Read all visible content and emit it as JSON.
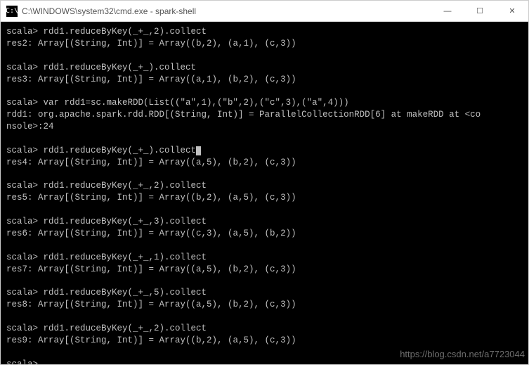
{
  "titlebar": {
    "icon_label": "C:\\",
    "title": "C:\\WINDOWS\\system32\\cmd.exe - spark-shell"
  },
  "window_controls": {
    "minimize": "—",
    "maximize": "☐",
    "close": "✕"
  },
  "terminal": {
    "blocks": [
      {
        "cmd": "scala> rdd1.reduceByKey(_+_,2).collect",
        "out": "res2: Array[(String, Int)] = Array((b,2), (a,1), (c,3))"
      },
      {
        "cmd": "scala> rdd1.reduceByKey(_+_).collect",
        "out": "res3: Array[(String, Int)] = Array((a,1), (b,2), (c,3))"
      },
      {
        "cmd": "scala> var rdd1=sc.makeRDD(List((\"a\",1),(\"b\",2),(\"c\",3),(\"a\",4)))",
        "out": "rdd1: org.apache.spark.rdd.RDD[(String, Int)] = ParallelCollectionRDD[6] at makeRDD at <co",
        "out2": "nsole>:24"
      },
      {
        "cmd": "scala> rdd1.reduceByKey(_+_).collect",
        "cursor": true,
        "out": "res4: Array[(String, Int)] = Array((a,5), (b,2), (c,3))"
      },
      {
        "cmd": "scala> rdd1.reduceByKey(_+_,2).collect",
        "out": "res5: Array[(String, Int)] = Array((b,2), (a,5), (c,3))"
      },
      {
        "cmd": "scala> rdd1.reduceByKey(_+_,3).collect",
        "out": "res6: Array[(String, Int)] = Array((c,3), (a,5), (b,2))"
      },
      {
        "cmd": "scala> rdd1.reduceByKey(_+_,1).collect",
        "out": "res7: Array[(String, Int)] = Array((a,5), (b,2), (c,3))"
      },
      {
        "cmd": "scala> rdd1.reduceByKey(_+_,5).collect",
        "out": "res8: Array[(String, Int)] = Array((a,5), (b,2), (c,3))"
      },
      {
        "cmd": "scala> rdd1.reduceByKey(_+_,2).collect",
        "out": "res9: Array[(String, Int)] = Array((b,2), (a,5), (c,3))"
      }
    ],
    "prompt_last": "scala>"
  },
  "watermark": "https://blog.csdn.net/a7723044"
}
